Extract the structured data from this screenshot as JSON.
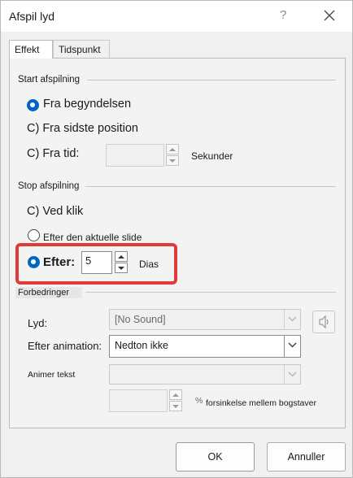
{
  "window": {
    "title": "Afspil lyd",
    "help_glyph": "?",
    "close_icon": "close-icon"
  },
  "tabs": [
    {
      "label": "Effekt",
      "active": true
    },
    {
      "label": "Tidspunkt",
      "active": false
    }
  ],
  "start": {
    "group_label": "Start afspilning",
    "from_beginning": "Fra begyndelsen",
    "from_last": "C) Fra sidste position",
    "from_time": "C) Fra tid:",
    "seconds_unit": "Sekunder",
    "time_value": ""
  },
  "stop": {
    "group_label": "Stop afspilning",
    "on_click": "C) Ved klik",
    "after_current": "Efter den aktuelle slide",
    "after_label": "Efter:",
    "after_value": "5",
    "slides_unit": "Dias"
  },
  "enhancements": {
    "group_label": "Forbedringer",
    "sound_label": "Lyd:",
    "sound_value": "[No Sound]",
    "after_anim_label": "Efter animation:",
    "after_anim_value": "Nedton ikke",
    "animate_text_label": "Animer tekst",
    "animate_text_value": "",
    "delay_value": "",
    "percent_sign": "%",
    "delay_suffix": "forsinkelse mellem bogstaver"
  },
  "buttons": {
    "ok": "OK",
    "cancel": "Annuller"
  },
  "colors": {
    "accent": "#0067c0",
    "highlight": "#e03a3a"
  }
}
